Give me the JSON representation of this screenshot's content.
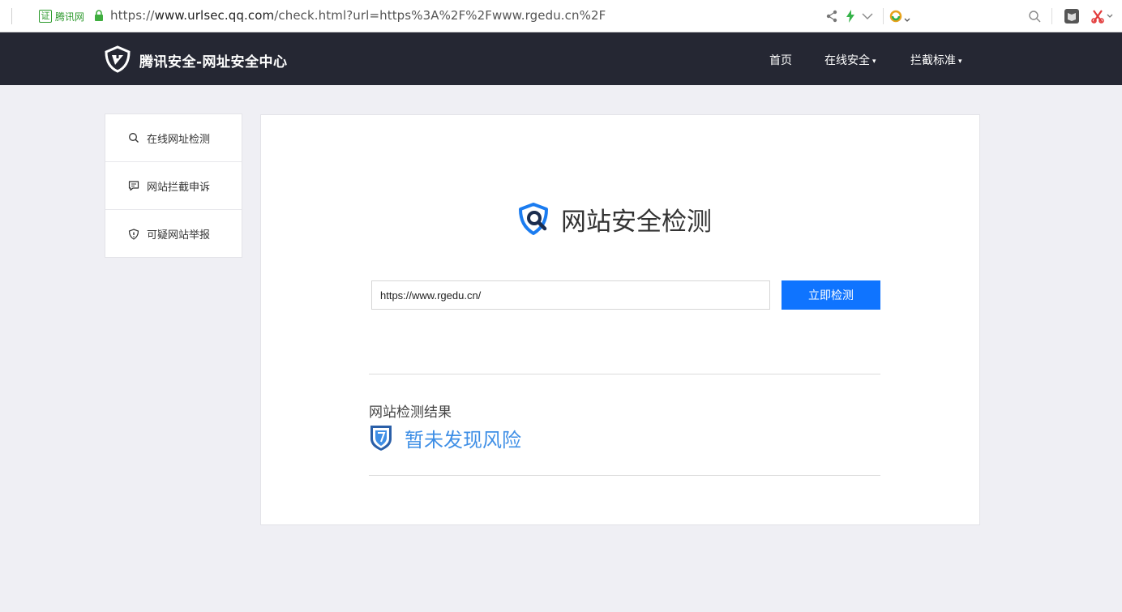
{
  "browser": {
    "cert_badge": "证",
    "cert_label": "腾讯网",
    "url_scheme": "https://",
    "url_host": "www.urlsec.qq.com",
    "url_path": "/check.html?url=https%3A%2F%2Fwww.rgedu.cn%2F",
    "icons": [
      "share-icon",
      "lightning-icon",
      "chevron-down-icon",
      "browser-logo-icon",
      "search-icon",
      "reader-icon",
      "scissors-icon"
    ]
  },
  "header": {
    "site_title": "腾讯安全-网址安全中心",
    "nav": [
      {
        "label": "首页",
        "has_dropdown": false
      },
      {
        "label": "在线安全",
        "has_dropdown": true
      },
      {
        "label": "拦截标准",
        "has_dropdown": true
      }
    ],
    "caret": "▾"
  },
  "sidebar": {
    "items": [
      {
        "label": "在线网址检测",
        "icon": "search-icon"
      },
      {
        "label": "网站拦截申诉",
        "icon": "message-icon"
      },
      {
        "label": "可疑网站举报",
        "icon": "shield-alert-icon"
      }
    ]
  },
  "main": {
    "title": "网站安全检测",
    "input_value": "https://www.rgedu.cn/",
    "check_button": "立即检测",
    "result_label": "网站检测结果",
    "result_text": "暂未发现风险"
  },
  "colors": {
    "nav_bg": "#252733",
    "page_bg": "#efeff4",
    "primary": "#0f74ff",
    "result_blue": "#3f8fe6",
    "cert_green": "#2d9a2d"
  }
}
